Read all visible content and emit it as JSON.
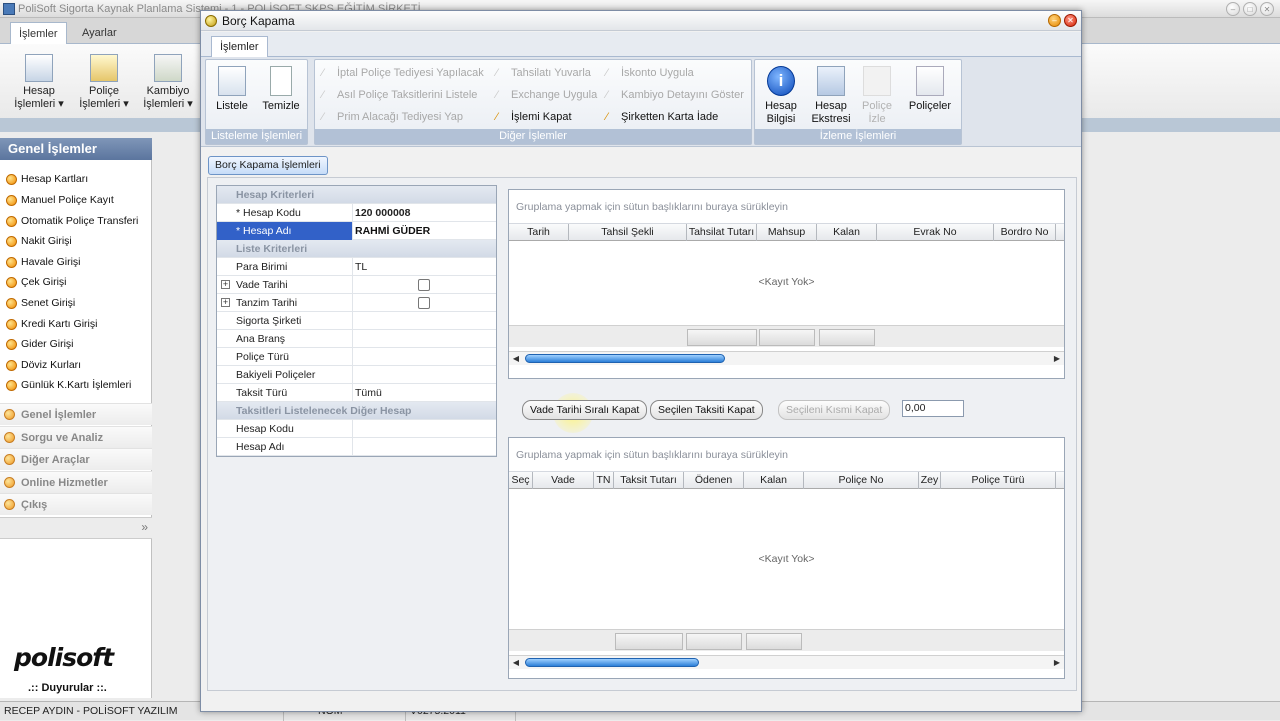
{
  "main_window": {
    "title": "PoliSoft Sigorta Kaynak Planlama Sistemi - 1 - POLİSOFT SKPS EĞİTİM ŞİRKETİ",
    "tabs": [
      {
        "label": "İşlemler",
        "active": true
      },
      {
        "label": "Ayarlar",
        "active": false
      }
    ],
    "ribbon": [
      {
        "label": "Hesap\nİşlemleri ▾",
        "icon": "ledger-icon"
      },
      {
        "label": "Poliçe\nİşlemleri ▾",
        "icon": "policy-icon"
      },
      {
        "label": "Kambiyo\nİşlemleri ▾",
        "icon": "exchange-icon"
      }
    ]
  },
  "nav": {
    "header": "Genel İşlemler",
    "items": [
      "Hesap Kartları",
      "Manuel Poliçe Kayıt",
      "Otomatik Poliçe Transferi",
      "Nakit Girişi",
      "Havale Girişi",
      "Çek Girişi",
      "Senet Girişi",
      "Kredi Kartı Girişi",
      "Gider Girişi",
      "Döviz Kurları",
      "Günlük K.Kartı İşlemleri"
    ],
    "groups": [
      "Genel İşlemler",
      "Sorgu ve Analiz",
      "Diğer Araçlar",
      "Online Hizmetler",
      "Çıkış"
    ],
    "expand": "»",
    "logo_main": "polisoft",
    "announcements": ".:: Duyurular ::."
  },
  "status_bar": {
    "user": "RECEP AYDIN - POLİSOFT YAZILIM",
    "mode": "NOM",
    "version": "V0275.2011"
  },
  "dialog": {
    "title": "Borç Kapama",
    "tab": "İşlemler",
    "groups": {
      "listing": {
        "label": "Listeleme İşlemleri",
        "buttons": [
          {
            "label": "Listele"
          },
          {
            "label": "Temizle"
          }
        ]
      },
      "other": {
        "label": "Diğer İşlemler",
        "buttons": [
          {
            "label": "İptal Poliçe Tediyesi Yapılacak",
            "enabled": false
          },
          {
            "label": "Asıl Poliçe Taksitlerini Listele",
            "enabled": false
          },
          {
            "label": "Prim Alacağı Tediyesi Yap",
            "enabled": false
          },
          {
            "label": "Tahsilatı Yuvarla",
            "enabled": false
          },
          {
            "label": "Exchange Uygula",
            "enabled": false
          },
          {
            "label": "İşlemi Kapat",
            "enabled": true
          },
          {
            "label": "İskonto Uygula",
            "enabled": false
          },
          {
            "label": "Kambiyo Detayını Göster",
            "enabled": false
          },
          {
            "label": "Şirketten Karta İade",
            "enabled": true
          }
        ]
      },
      "monitor": {
        "label": "İzleme İşlemleri",
        "buttons": [
          {
            "label": "Hesap\nBilgisi"
          },
          {
            "label": "Hesap\nEkstresi"
          },
          {
            "label": "Poliçe\nİzle"
          },
          {
            "label": "Poliçeler"
          }
        ]
      }
    },
    "sub_tab": "Borç Kapama İşlemleri",
    "criteria": {
      "cat_account": "Hesap Kriterleri",
      "account_code_label": "* Hesap Kodu",
      "account_code": "120 000008",
      "account_name_label": "* Hesap Adı",
      "account_name": "RAHMİ GÜDER",
      "cat_list": "Liste Kriterleri",
      "currency_label": "Para Birimi",
      "currency": "TL",
      "due_date_label": "Vade Tarihi",
      "issue_date_label": "Tanzim Tarihi",
      "insurer_label": "Sigorta Şirketi",
      "main_branch_label": "Ana Branş",
      "policy_type_label": "Poliçe Türü",
      "balance_label": "Bakiyeli Poliçeler",
      "installment_type_label": "Taksit Türü",
      "installment_type": "Tümü",
      "cat_other": "Taksitleri Listelenecek Diğer Hesap",
      "other_code_label": "Hesap Kodu",
      "other_name_label": "Hesap Adı"
    },
    "grid_top": {
      "group_hint": "Gruplama yapmak için sütun başlıklarını buraya sürükleyin",
      "columns": [
        "Tarih",
        "Tahsil Şekli",
        "Tahsilat Tutarı",
        "Mahsup",
        "Kalan",
        "Evrak No",
        "Bordro No"
      ],
      "empty": "<Kayıt Yok>"
    },
    "actions": {
      "by_due": "Vade Tarihi Sıralı Kapat",
      "selected": "Seçilen Taksiti Kapat",
      "partial": "Seçileni Kısmi Kapat",
      "amount": "0,00"
    },
    "grid_bottom": {
      "group_hint": "Gruplama yapmak için sütun başlıklarını buraya sürükleyin",
      "columns": [
        "Seç",
        "Vade",
        "TN",
        "Taksit Tutarı",
        "Ödenen",
        "Kalan",
        "Poliçe No",
        "Zey",
        "Poliçe Türü"
      ],
      "empty": "<Kayıt Yok>"
    }
  }
}
